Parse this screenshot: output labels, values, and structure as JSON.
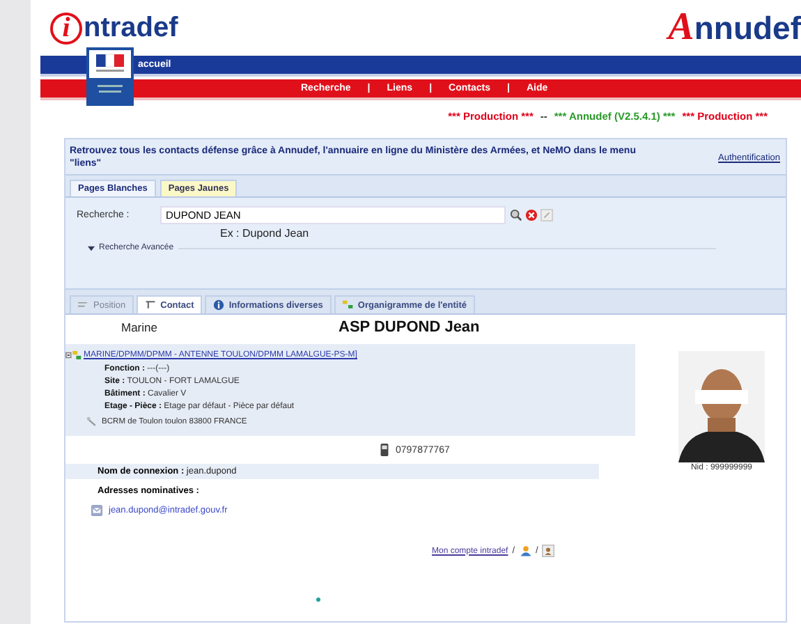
{
  "header": {
    "site_logo": {
      "initial": "i",
      "rest": "ntradef"
    },
    "app_logo": {
      "initial": "A",
      "rest": "nnudef"
    },
    "home_link": "accueil",
    "nav": [
      "Recherche",
      "Liens",
      "Contacts",
      "Aide"
    ],
    "nav_separator": "|"
  },
  "status_line": [
    {
      "text": "*** Production ***",
      "color": "#e0001a"
    },
    {
      "text": "--",
      "color": "#333333"
    },
    {
      "text": "*** Annudef (V2.5.4.1) ***",
      "color": "#2a9a2a"
    },
    {
      "text": "*** Production ***",
      "color": "#e0001a"
    }
  ],
  "intro": {
    "text": "Retrouvez tous les contacts défense grâce à Annudef, l'annuaire en ligne du Ministère des Armées, et NeMO dans le menu \"liens\"",
    "auth_link": "Authentification"
  },
  "directory_tabs": [
    {
      "label": "Pages Blanches",
      "selected": true
    },
    {
      "label": "Pages Jaunes",
      "selected": false
    }
  ],
  "search": {
    "label": "Recherche :",
    "value": "DUPOND JEAN",
    "example": "Ex : Dupond Jean",
    "advanced": "Recherche Avancée"
  },
  "contact_tabs": [
    {
      "label": "Position",
      "selected": false,
      "disabled": true
    },
    {
      "label": "Contact",
      "selected": true,
      "disabled": false
    },
    {
      "label": "Informations diverses",
      "selected": false,
      "disabled": false
    },
    {
      "label": "Organigramme de l'entité",
      "selected": false,
      "disabled": false
    }
  ],
  "contact": {
    "branch": "Marine",
    "name": "ASP DUPOND Jean",
    "unit": "MARINE/DPMM/DPMM - ANTENNE TOULON/DPMM LAMALGUE-PS-M]",
    "fields": [
      {
        "label": "Fonction :",
        "value": "---(---)"
      },
      {
        "label": "Site :",
        "value": "TOULON - FORT LAMALGUE"
      },
      {
        "label": "Bâtiment :",
        "value": "Cavalier V"
      },
      {
        "label": "Etage - Pièce :",
        "value": "Etage par défaut - Pièce par défaut"
      }
    ],
    "address": "BCRM de Toulon toulon 83800 FRANCE",
    "phone": "0797877767",
    "photo_caption": "Nid : 999999999",
    "login_label": "Nom de connexion :",
    "login": "jean.dupond",
    "addresses_label": "Adresses nominatives :",
    "email": "jean.dupond@intradef.gouv.fr"
  },
  "footer": {
    "account_link": "Mon compte intradef",
    "separators": [
      "/",
      "/"
    ]
  }
}
